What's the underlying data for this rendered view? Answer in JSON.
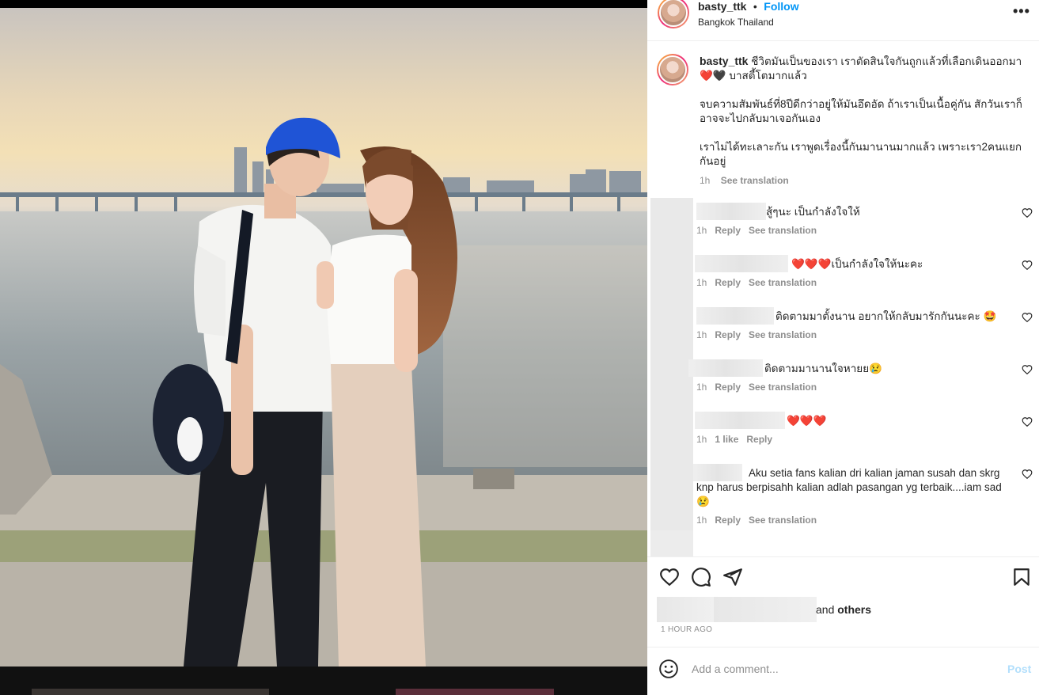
{
  "post": {
    "username": "basty_ttk",
    "separator": "•",
    "follow_label": "Follow",
    "location": "Bangkok Thailand",
    "more_icon": "more-horizontal-icon"
  },
  "caption": {
    "username": "basty_ttk",
    "line1": "ชีวิตมันเป็นของเรา เราตัดสินใจกันถูกแล้วที่เลือกเดินออกมา",
    "line1b_emoji": "❤️🖤",
    "line1b_text": "บาสตี้โตมากแล้ว",
    "paragraph2": "จบความสัมพันธ์ที่8ปีดีกว่าอยู่ให้มันอึดอัด ถ้าเราเป็นเนื้อคู่กัน สักวันเราก็อาจจะไปกลับมาเจอกันเอง",
    "paragraph3": "เราไม่ได้ทะเลาะกัน เราพูดเรื่องนี้กันมานานมากแล้ว เพราะเรา2คนแยกกันอยู่",
    "time": "1h",
    "see_translation": "See translation"
  },
  "comments": [
    {
      "text": "สู้ๆนะ เป็นกำลังใจให้",
      "time": "1h",
      "a1": "Reply",
      "a2": "See translation"
    },
    {
      "emoji": "❤️❤️❤️",
      "text": "เป็นกำลังใจให้นะคะ",
      "time": "1h",
      "a1": "Reply",
      "a2": "See translation"
    },
    {
      "text": "ติดตามมาตั้งนาน อยากให้กลับมารักกันนะคะ 🤩",
      "time": "1h",
      "a1": "Reply",
      "a2": "See translation"
    },
    {
      "text": "ติดตามมานานใจหายย😢",
      "time": "1h",
      "a1": "Reply",
      "a2": "See translation"
    },
    {
      "emoji": "❤️❤️❤️",
      "time": "1h",
      "a1": "1 like",
      "a2": "Reply"
    },
    {
      "text": "Aku setia fans kalian dri kalian jaman susah dan skrg knp harus berpisahh kalian adlah pasangan yg terbaik....iam sad 😢",
      "time": "1h",
      "a1": "Reply",
      "a2": "See translation"
    }
  ],
  "actions": {
    "like_icon": "heart-icon",
    "comment_icon": "comment-icon",
    "share_icon": "share-icon",
    "save_icon": "bookmark-icon"
  },
  "likes": {
    "and": "and",
    "others": "others"
  },
  "time_ago": "1 HOUR AGO",
  "add_comment": {
    "placeholder": "Add a comment...",
    "post_label": "Post"
  },
  "colors": {
    "link": "#0095f6",
    "muted": "#8e8e8e",
    "cap_blue": "#1f54d6"
  }
}
